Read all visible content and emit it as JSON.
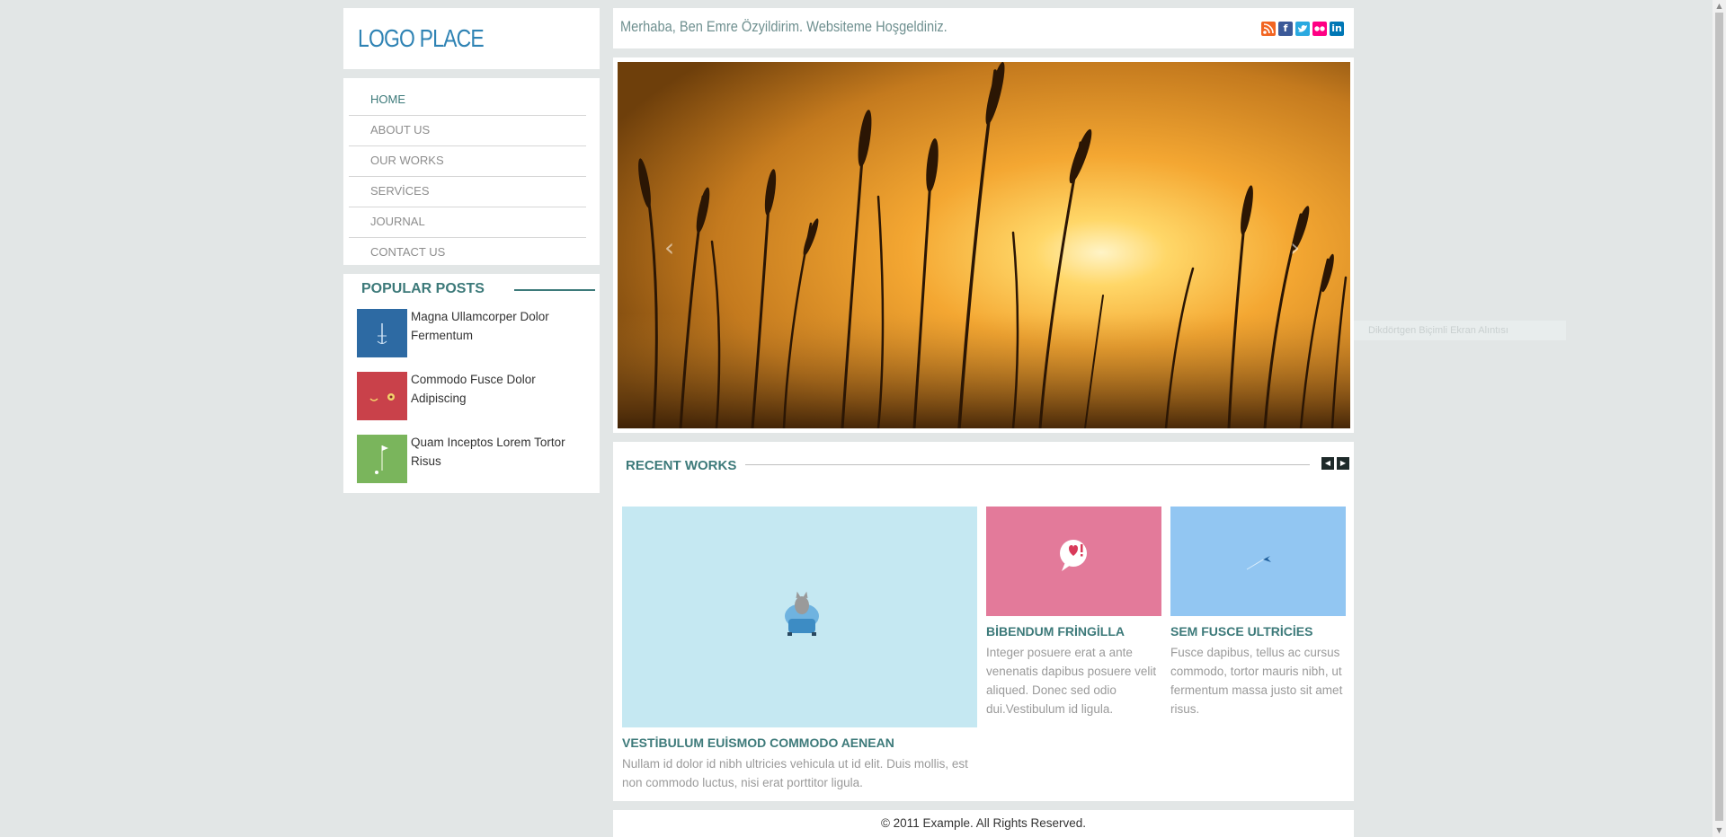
{
  "logo": {
    "text": "LOGO PLACE"
  },
  "nav": {
    "items": [
      {
        "label": "HOME"
      },
      {
        "label": "ABOUT US"
      },
      {
        "label": "OUR WORKS"
      },
      {
        "label": "SERVİCES"
      },
      {
        "label": "JOURNAL"
      },
      {
        "label": "CONTACT US"
      }
    ]
  },
  "popular": {
    "title": "POPULAR POSTS",
    "posts": [
      {
        "title": "Magna Ullamcorper Dolor Fermentum",
        "thumb_color": "#2d6aa3"
      },
      {
        "title": "Commodo Fusce Dolor Adipiscing",
        "thumb_color": "#c9414a"
      },
      {
        "title": "Quam Inceptos Lorem Tortor Risus",
        "thumb_color": "#7ab55c"
      }
    ]
  },
  "header": {
    "welcome": "Merhaba, Ben Emre Özyildirim. Websiteme Hoşgeldiniz.",
    "social": [
      {
        "icon": "rss-icon",
        "color": "#f26522"
      },
      {
        "icon": "facebook-icon",
        "color": "#3b5998"
      },
      {
        "icon": "twitter-icon",
        "color": "#2aa9e0"
      },
      {
        "icon": "flickr-icon",
        "color": "#ff0084"
      },
      {
        "icon": "linkedin-icon",
        "color": "#0077b5"
      }
    ]
  },
  "slider": {
    "prev_label": "‹",
    "next_label": "›"
  },
  "works": {
    "title": "RECENT WORKS",
    "prev_label": "◀",
    "next_label": "▶",
    "items": [
      {
        "title": "VESTİBULUM EUİSMOD COMMODO AENEAN",
        "text": "Nullam id dolor id nibh ultricies vehicula ut id elit. Duis mollis, est non commodo luctus, nisi erat porttitor ligula.",
        "color": "#c5e8f2"
      },
      {
        "title": "BİBENDUM FRİNGİLLA",
        "text": "Integer posuere erat a ante venenatis dapibus posuere velit aliqued. Donec sed odio dui.Vestibulum id ligula.",
        "color": "#e37a9a"
      },
      {
        "title": "SEM FUSCE ULTRİCİES",
        "text": "Fusce dapibus, tellus ac cursus commodo, tortor mauris nibh, ut fermentum massa justo sit amet risus.",
        "color": "#92c6f2"
      }
    ]
  },
  "footer": {
    "text": "© 2011 Example. All Rights Reserved."
  },
  "ghost_tip": {
    "text": "Dikdörtgen Biçimli Ekran Alıntısı"
  }
}
